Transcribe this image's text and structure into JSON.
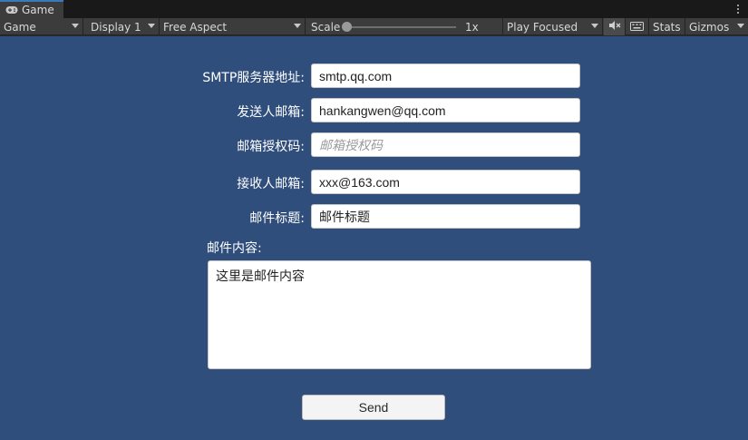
{
  "window": {
    "tab_label": "Game",
    "tab_icon": "gamepad-icon",
    "menu_icon": "kebab-menu-icon"
  },
  "toolbar": {
    "view_select": "Game",
    "display_select": "Display 1",
    "aspect_select": "Free Aspect",
    "scale_label": "Scale",
    "scale_value": "1x",
    "scale_level": 0.0,
    "play_mode_select": "Play Focused",
    "mute_icon": "audio-mute-icon",
    "keyboard_icon": "keyboard-icon",
    "stats_label": "Stats",
    "gizmos_label": "Gizmos"
  },
  "form": {
    "smtp_label": "SMTP服务器地址:",
    "smtp_value": "smtp.qq.com",
    "sender_label": "发送人邮箱:",
    "sender_value": "hankangwen@qq.com",
    "auth_label": "邮箱授权码:",
    "auth_placeholder": "邮箱授权码",
    "receiver_label": "接收人邮箱:",
    "receiver_value": "xxx@163.com",
    "subject_label": "邮件标题:",
    "subject_value": "邮件标题",
    "content_label": "邮件内容:",
    "content_value": "这里是邮件内容",
    "send_label": "Send"
  },
  "colors": {
    "game_background": "#2f4e7c",
    "toolbar": "#3c3c3c",
    "tab_accent": "#3a79bb"
  }
}
